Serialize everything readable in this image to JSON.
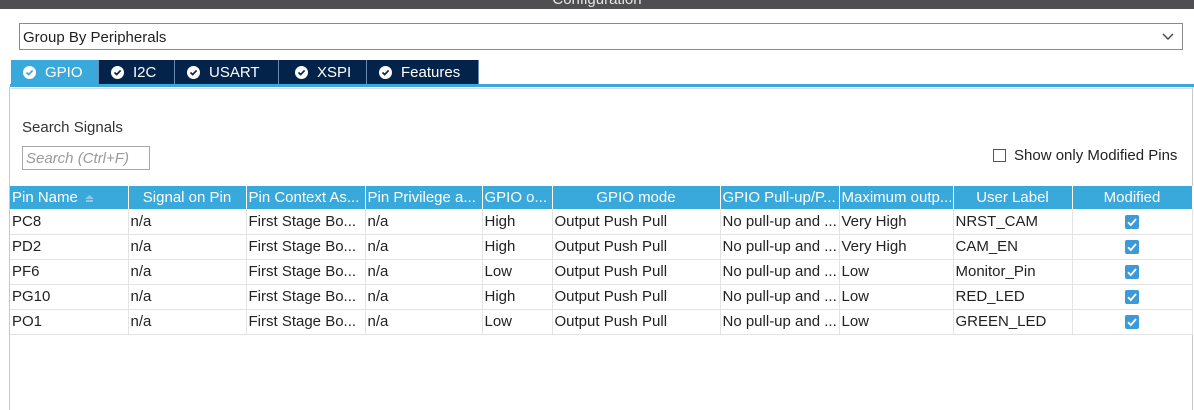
{
  "window": {
    "title": "Configuration"
  },
  "group_by": {
    "value": "Group By Peripherals"
  },
  "tabs": [
    {
      "label": "GPIO",
      "active": true
    },
    {
      "label": "I2C",
      "active": false
    },
    {
      "label": "USART",
      "active": false
    },
    {
      "label": "XSPI",
      "active": false
    },
    {
      "label": "Features",
      "active": false
    }
  ],
  "search": {
    "label": "Search Signals",
    "placeholder": "Search (Ctrl+F)",
    "value": ""
  },
  "filter": {
    "label": "Show only Modified Pins",
    "checked": false
  },
  "table": {
    "headers": [
      "Pin Name",
      "Signal on Pin",
      "Pin Context As...",
      "Pin Privilege a...",
      "GPIO o...",
      "GPIO mode",
      "GPIO Pull-up/P...",
      "Maximum outp...",
      "User Label",
      "Modified"
    ],
    "rows": [
      {
        "pin": "PC8",
        "signal": "n/a",
        "context": "First Stage Bo...",
        "privilege": "n/a",
        "output": "High",
        "mode": "Output Push Pull",
        "pull": "No pull-up and ...",
        "speed": "Very High",
        "label": "NRST_CAM",
        "modified": true
      },
      {
        "pin": "PD2",
        "signal": "n/a",
        "context": "First Stage Bo...",
        "privilege": "n/a",
        "output": "High",
        "mode": "Output Push Pull",
        "pull": "No pull-up and ...",
        "speed": "Very High",
        "label": "CAM_EN",
        "modified": true
      },
      {
        "pin": "PF6",
        "signal": "n/a",
        "context": "First Stage Bo...",
        "privilege": "n/a",
        "output": "Low",
        "mode": "Output Push Pull",
        "pull": "No pull-up and ...",
        "speed": "Low",
        "label": "Monitor_Pin",
        "modified": true
      },
      {
        "pin": "PG10",
        "signal": "n/a",
        "context": "First Stage Bo...",
        "privilege": "n/a",
        "output": "High",
        "mode": "Output Push Pull",
        "pull": "No pull-up and ...",
        "speed": "Low",
        "label": "RED_LED",
        "modified": true
      },
      {
        "pin": "PO1",
        "signal": "n/a",
        "context": "First Stage Bo...",
        "privilege": "n/a",
        "output": "Low",
        "mode": "Output Push Pull",
        "pull": "No pull-up and ...",
        "speed": "Low",
        "label": "GREEN_LED",
        "modified": true
      }
    ]
  },
  "colors": {
    "accent": "#39a9dc",
    "tab_inactive": "#03234b",
    "title_bar": "#4f4f52",
    "checkbox": "#3d9ad8"
  },
  "icons": {
    "tab_check": "check-circle-icon",
    "dropdown": "chevron-down-icon",
    "sort": "sort-icon",
    "modified": "checkbox-checked-icon"
  }
}
